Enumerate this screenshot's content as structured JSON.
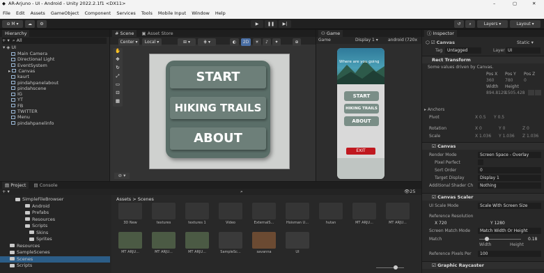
{
  "window": {
    "title": "AR-Arjuno - UI - Android - Unity 2022.2.1f1 <DX11>",
    "min": "–",
    "max": "▢",
    "close": "✕"
  },
  "menu": [
    "File",
    "Edit",
    "Assets",
    "GameObject",
    "Component",
    "Services",
    "Tools",
    "Mobile Input",
    "Window",
    "Help"
  ],
  "toolbar": {
    "account": "⊖ M ▾",
    "cloud": "☁",
    "collab": "⚙",
    "play": "▶",
    "pause": "❚❚",
    "step": "▶|",
    "layers": "Layers",
    "layout": "Layout"
  },
  "hierarchy": {
    "tab": "Hierarchy",
    "search": "All",
    "root": "UI",
    "items": [
      "Main Camera",
      "Directional Light",
      "EventSystem",
      "Canvas",
      "kaurt",
      "pindahpanelabout",
      "pindahscene",
      "IG",
      "YT",
      "FB",
      "TWITTER",
      "Menu",
      "pindahpanelinfo"
    ]
  },
  "scene": {
    "tabs": [
      "Scene",
      "Asset Store"
    ],
    "pivot": "Center ▾",
    "space": "Local ▾",
    "mode2d": "2D",
    "buttons": [
      "START",
      "HIKING TRAILS",
      "ABOUT"
    ]
  },
  "game": {
    "tab": "Game",
    "dropdown": "Game",
    "display": "Display 1 ▾",
    "aspect": "android (720x",
    "hero": "Where are you going",
    "buttons": [
      "START",
      "HIKING TRAILS",
      "ABOUT"
    ],
    "exit": "EXIT"
  },
  "project": {
    "tabs": [
      "Project",
      "Console"
    ],
    "tree": [
      "SimpleFileBrowser",
      "Android",
      "Prefabs",
      "Resources",
      "Scripts",
      "Skins",
      "Sprites",
      "Resources",
      "SampleScenes",
      "Scenes",
      "Scripts"
    ],
    "breadcrumb": "Assets > Scenes",
    "row1": [
      "3D New",
      "textures",
      "textures 1",
      "Video",
      "ExternalS...",
      "Hoisman U...",
      "hutan",
      "MT ARJU...",
      "MT ARJU..."
    ],
    "row2": [
      "MT ARJU...",
      "MT ARJU...",
      "MT ARJU...",
      "SampleSc...",
      "savanna",
      "UI"
    ],
    "count": "25"
  },
  "inspector": {
    "tab": "Inspector",
    "object": "Canvas",
    "static": "Static ▾",
    "tag_label": "Tag",
    "tag": "Untagged",
    "layer_label": "Layer",
    "layer": "UI",
    "rect": {
      "title": "Rect Transform",
      "note": "Some values driven by Canvas.",
      "labels": [
        "Pos X",
        "Pos Y",
        "Pos Z"
      ],
      "pos": [
        "360",
        "780",
        "0"
      ],
      "wh_labels": [
        "Width",
        "Height"
      ],
      "wh": [
        "894.8129",
        "1505.428"
      ],
      "anchors": "Anchors",
      "pivot_label": "Pivot",
      "pivot": [
        "X 0.5",
        "Y 0.5"
      ],
      "rotation_label": "Rotation",
      "rotation": [
        "X 0",
        "Y 0",
        "Z 0"
      ],
      "scale_label": "Scale",
      "scale": [
        "X 1.036",
        "Y 1.036",
        "Z 1.036"
      ]
    },
    "canvas": {
      "title": "Canvas",
      "render_label": "Render Mode",
      "render": "Screen Space - Overlay",
      "pp_label": "Pixel Perfect",
      "so_label": "Sort Order",
      "so": "0",
      "td_label": "Target Display",
      "td": "Display 1",
      "asc_label": "Additional Shader Ch",
      "asc": "Nothing"
    },
    "scaler": {
      "title": "Canvas Scaler",
      "mode_label": "UI Scale Mode",
      "mode": "Scale With Screen Size",
      "ref_label": "Reference Resolution",
      "x": "X 720",
      "y": "Y 1280",
      "match_mode_label": "Screen Match Mode",
      "match_mode": "Match Width Or Height",
      "match_label": "Match",
      "match": "0.18",
      "width": "Width",
      "height": "Height",
      "ppu_label": "Reference Pixels Per",
      "ppu": "100"
    },
    "raycaster": {
      "title": "Graphic Raycaster"
    }
  }
}
